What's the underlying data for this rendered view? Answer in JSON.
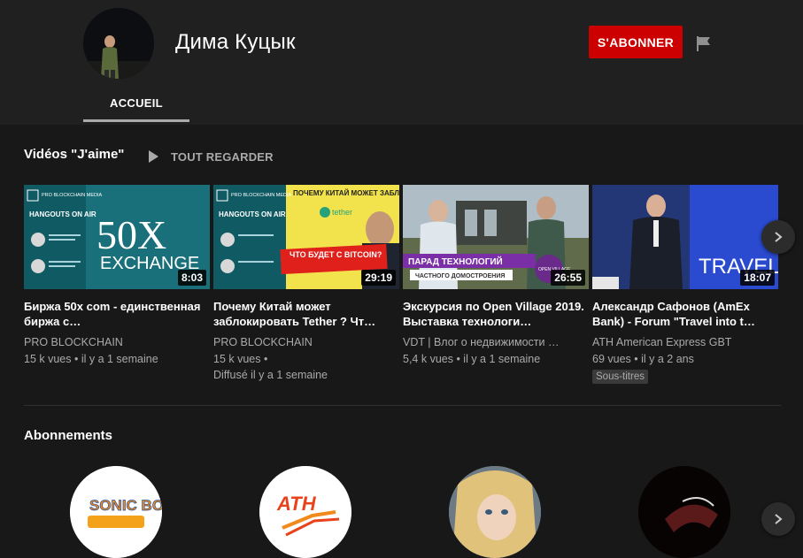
{
  "channel": {
    "name": "Дима Куцык",
    "subscribe_label": "S'ABONNER",
    "tab_home": "ACCUEIL"
  },
  "liked": {
    "title": "Vidéos \"J'aime\"",
    "play_all": "TOUT REGARDER",
    "videos": [
      {
        "title": "Биржа 50x com - единственная биржа с…",
        "channel": "PRO BLOCKCHAIN",
        "meta1": "15 k vues • il y a 1 semaine",
        "duration": "8:03",
        "thumb_brand": "PRO BLOCKCHAIN MEDIA",
        "thumb_hangouts": "HANGOUTS ON AIR",
        "thumb_big": "50X",
        "thumb_big_sub": "EXCHANGE"
      },
      {
        "title": "Почему Китай может заблокировать Tether ? Чт…",
        "channel": "PRO BLOCKCHAIN",
        "meta1": "15 k vues •",
        "meta2": "Diffusé il y a 1 semaine",
        "duration": "29:19",
        "thumb_brand": "PRO BLOCKCHAIN MEDIA",
        "thumb_hangouts": "HANGOUTS ON AIR",
        "thumb_q": "ПОЧЕМУ КИТАЙ МОЖЕТ ЗАБЛОКИРОВАТЬ",
        "thumb_tether": "tether",
        "thumb_red": "ЧТО БУДЕТ С BITCOIN?"
      },
      {
        "title": "Экскурсия по Open Village 2019. Выставка технологи…",
        "channel": "VDT | Влог о недвижимости …",
        "meta1": "5,4 k vues • il y a 1 semaine",
        "duration": "26:55",
        "thumb_banner1": "ПАРАД ТЕХНОЛОГИЙ",
        "thumb_banner2": "ЧАСТНОГО ДОМОСТРОЕНИЯ",
        "thumb_logo": "OPEN VILLAGE"
      },
      {
        "title": "Александр Сафонов (AmEx Bank) - Forum \"Travel into t…",
        "channel": "ATH American Express GBT",
        "meta1": "69 vues • il y a 2 ans",
        "badge": "Sous-titres",
        "duration": "18:07",
        "thumb_text": "TRAVEL"
      }
    ]
  },
  "subscriptions": {
    "title": "Abonnements",
    "items": [
      {
        "logo": "SONIC BOOM"
      },
      {
        "logo": "ATH"
      },
      {
        "logo": ""
      },
      {
        "logo": ""
      }
    ]
  },
  "colors": {
    "background": "#181818",
    "header": "#202020",
    "subscribe": "#cc0000",
    "secondary_text": "#aaaaaa"
  }
}
